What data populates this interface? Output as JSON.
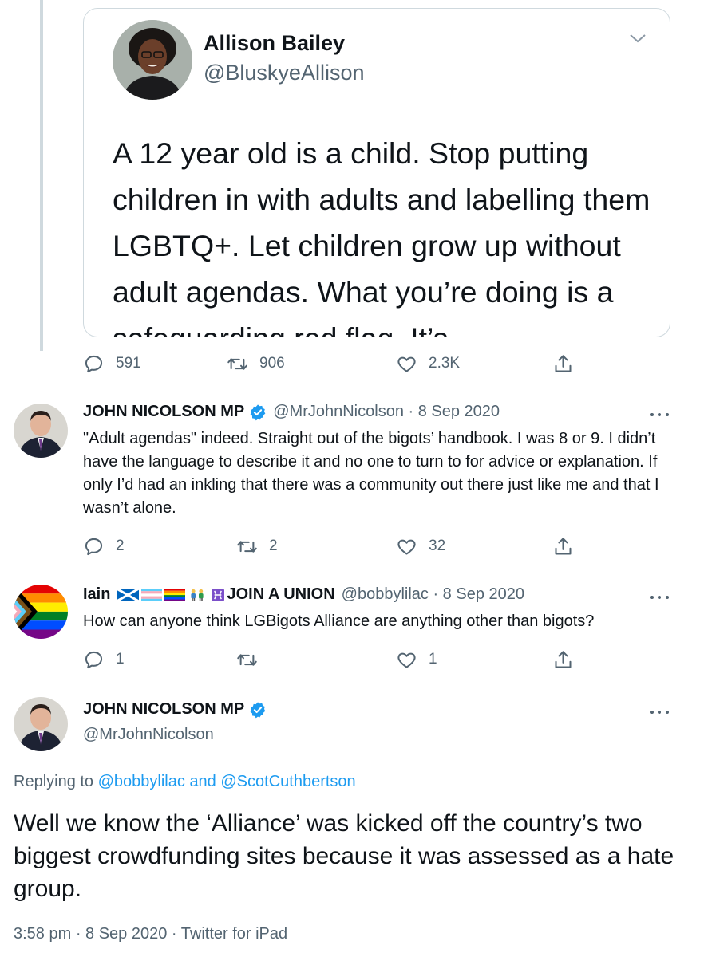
{
  "quoted_tweet": {
    "name": "Allison Bailey",
    "handle": "@BluskyeAllison",
    "text": "A 12 year old is a child. Stop putting children in with adults and labelling them LGBTQ+. Let children grow up without adult agendas. What you’re doing is a safeguarding red flag. It’s"
  },
  "quote_actions": {
    "replies": "591",
    "retweets": "906",
    "likes": "2.3K"
  },
  "reply1": {
    "name": "JOHN NICOLSON MP",
    "meta": "@MrJohnNicolson · 8 Sep 2020",
    "text": "\"Adult agendas\" indeed. Straight out of the bigots’ handbook. I was 8 or 9. I didn’t have the language to describe it and no one to turn to for advice or explanation. If only I’d had an inkling that there was a community out there just like me and that I wasn’t alone.",
    "replies": "2",
    "retweets": "2",
    "likes": "32"
  },
  "reply2": {
    "name": "Iain",
    "name_suffix": "JOIN A UNION",
    "meta": "@bobbylilac · 8 Sep 2020",
    "text": "How can anyone think LGBigots Alliance are anything other than bigots?",
    "replies": "1",
    "retweets": "",
    "likes": "1"
  },
  "main_tweet": {
    "name": "JOHN NICOLSON MP",
    "handle": "@MrJohnNicolson",
    "replying_prefix": "Replying to",
    "replying_user1": "@bobbylilac",
    "replying_and": "and",
    "replying_user2": "@ScotCuthbertson",
    "text": "Well we know the ‘Alliance’ was kicked off the country’s two biggest crowdfunding sites because it was assessed as a hate group.",
    "meta": "3:58 pm · 8 Sep 2020 · Twitter for iPad"
  },
  "icons": {
    "reply": "reply-icon",
    "retweet": "retweet-icon",
    "like": "heart-icon",
    "share": "share-icon",
    "verified": "verified-badge-icon",
    "more": "more-icon"
  },
  "colors": {
    "text": "#0f1419",
    "muted": "#536471",
    "link": "#1d9bf0",
    "border": "#cfd9de",
    "verified": "#1d9bf0"
  }
}
